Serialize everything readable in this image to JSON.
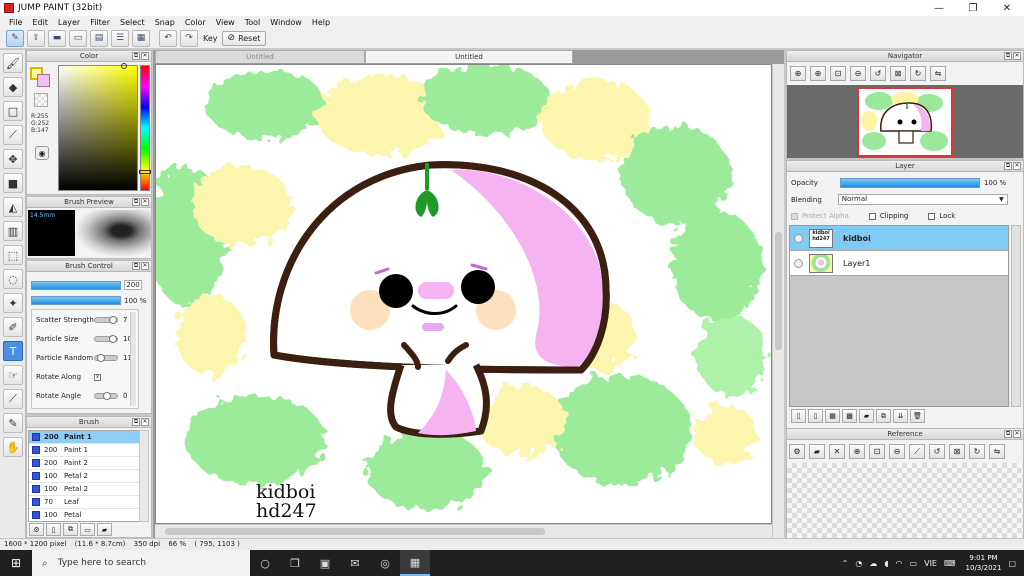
{
  "window": {
    "title": "JUMP PAINT (32bit)",
    "minimize": "—",
    "maximize": "❐",
    "close": "✕"
  },
  "menu": [
    "File",
    "Edit",
    "Layer",
    "Filter",
    "Select",
    "Snap",
    "Color",
    "View",
    "Tool",
    "Window",
    "Help"
  ],
  "toolbar": {
    "key_label": "Key",
    "reset_label": "Reset"
  },
  "color_panel": {
    "title": "Color",
    "r": "R:255",
    "g": "G:252",
    "b": "B:147",
    "fg_color": "#ffff93",
    "bg_color": "#f0c0f0"
  },
  "brush_preview": {
    "title": "Brush Preview",
    "size": "14.5mm"
  },
  "brush_control": {
    "title": "Brush Control",
    "size_value": "200",
    "opacity_value": "100 %",
    "params": [
      {
        "label": "Scatter Strength",
        "value": "7"
      },
      {
        "label": "Particle Size",
        "value": "100"
      },
      {
        "label": "Particle Random",
        "value": "11"
      },
      {
        "label": "Rotate Along",
        "value": "x"
      },
      {
        "label": "Rotate Angle",
        "value": "0"
      }
    ]
  },
  "brush_panel": {
    "title": "Brush",
    "items": [
      {
        "size": "200",
        "name": "Paint 1"
      },
      {
        "size": "200",
        "name": "Paint 1"
      },
      {
        "size": "200",
        "name": "Paint 2"
      },
      {
        "size": "100",
        "name": "Petal 2"
      },
      {
        "size": "100",
        "name": "Petal 2"
      },
      {
        "size": "70",
        "name": "Leaf"
      },
      {
        "size": "100",
        "name": "Petal"
      }
    ]
  },
  "document": {
    "tab_inactive": "Untitled",
    "tab_active": "Untitled",
    "signature_line1": "kidboi",
    "signature_line2": "hd247"
  },
  "navigator": {
    "title": "Navigator"
  },
  "layer_panel": {
    "title": "Layer",
    "opacity_label": "Opacity",
    "opacity_value": "100 %",
    "opacity": 1.0,
    "blending_label": "Blending",
    "blending_value": "Normal",
    "protect_alpha": "Protect Alpha",
    "clipping": "Clipping",
    "lock": "Lock",
    "layers": [
      {
        "name": "kidboi",
        "thumb_text": "kidboi hd247"
      },
      {
        "name": "Layer1",
        "thumb_text": ""
      }
    ]
  },
  "reference_panel": {
    "title": "Reference"
  },
  "status": {
    "dimensions": "1600 * 1200 pixel",
    "physical": "(11.6 * 8.7cm)",
    "dpi": "350 dpi",
    "zoom": "66 %",
    "cursor": "( 795, 1103 )"
  },
  "taskbar": {
    "search_placeholder": "Type here to search",
    "lang": "VIE",
    "time": "9:01 PM",
    "date": "10/3/2021"
  },
  "colors": {
    "accent": "#1b8fe0",
    "selected_row": "#80cbf4",
    "cap_outline": "#3b1f10",
    "pink": "#f6b3f2",
    "cheek": "#fde0bd",
    "leaf": "#1e9a29"
  }
}
